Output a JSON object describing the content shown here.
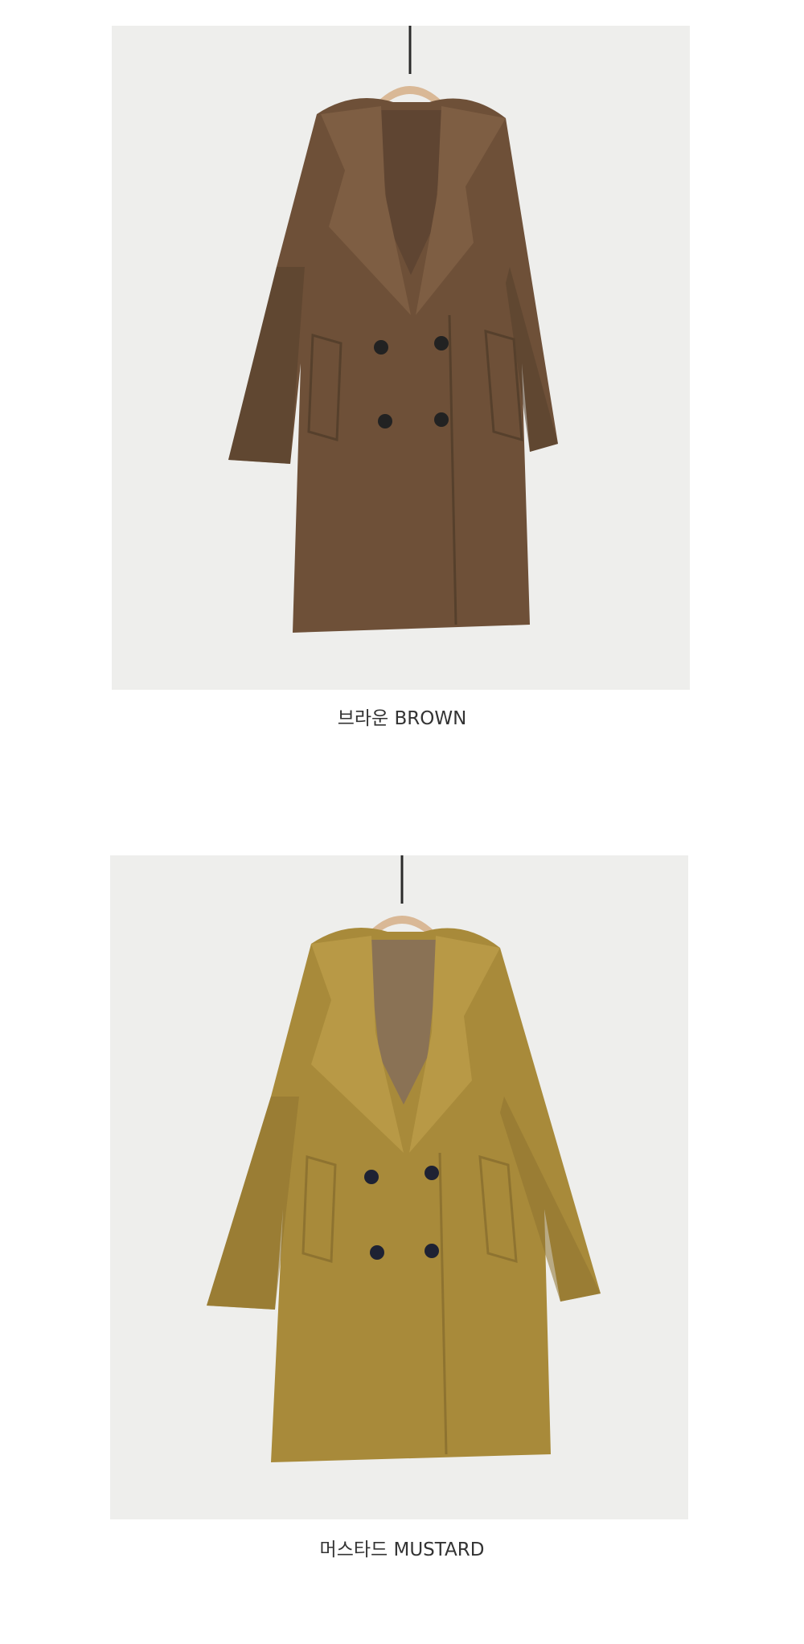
{
  "products": [
    {
      "caption": "브라운 BROWN",
      "colors": {
        "coat": "#6e5038",
        "coat_shadow": "#56402c",
        "coat_highlight": "#7e5e43",
        "lining": "#5f4532",
        "button": "#222222"
      }
    },
    {
      "caption": "머스타드 MUSTARD",
      "colors": {
        "coat": "#a88a3a",
        "coat_shadow": "#8e7330",
        "coat_highlight": "#b89946",
        "lining": "#8a7255",
        "button": "#1e2233"
      }
    }
  ],
  "colors": {
    "backdrop": "#eeeeec",
    "hanger": "#d9b896",
    "hanger_string": "#2a2a2a",
    "caption_text": "#333333"
  }
}
